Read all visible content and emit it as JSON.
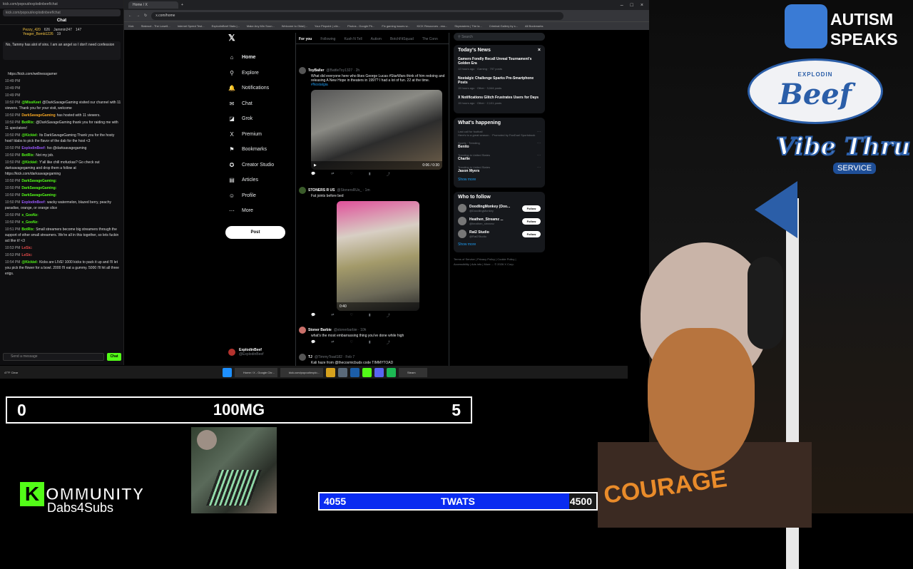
{
  "chat_window": {
    "title": "kick.com/popout/explodinbeef/chat",
    "url": "kick.com/popout/explodinbeef/chat",
    "header": "Chat",
    "leaderboard": [
      {
        "name": "Pezzy_420",
        "count": "626"
      },
      {
        "name": "Jammin247",
        "count": "147"
      },
      {
        "name": "Yeager_Bomb1226",
        "count": "19"
      }
    ],
    "pinned": "No, Tammy has alot of sins. I am an angel so I don't need confession",
    "messages": [
      {
        "time": "",
        "user": "",
        "text": "https://kick.com/wellnessgamer",
        "color": "#ffffff"
      },
      {
        "time": "10:49 PM",
        "user": "",
        "text": "",
        "color": "#e84b4b"
      },
      {
        "time": "10:49 PM",
        "user": "",
        "text": "",
        "color": "#e84b4b"
      },
      {
        "time": "10:49 PM",
        "user": "",
        "text": "",
        "color": "#e84b4b"
      },
      {
        "time": "10:50 PM",
        "user": "@MissKeet",
        "text": "@DarkSavageGaming visited our channel with 11 viewers. Thank you for your visit, welcome",
        "color": "#53fc18"
      },
      {
        "time": "10:50 PM",
        "user": "DarkSavageGaming",
        "text": "has hosted with 11 viewers.",
        "color": "#f5a623"
      },
      {
        "time": "10:50 PM",
        "user": "BotRix:",
        "text": "@DarkSavageGaming thank you for raiding me with 11 spectators!",
        "color": "#53fc18"
      },
      {
        "time": "10:50 PM",
        "user": "@Kickiel:",
        "text": "Its DarkSavageGaming Thank you for the hosty host! Idabs to pick the flavor of the dab for the host <3",
        "color": "#53fc18"
      },
      {
        "time": "10:50 PM",
        "user": "ExplodinBeef:",
        "text": "fso @darksavagegaming",
        "color": "#9b59ff"
      },
      {
        "time": "10:50 PM",
        "user": "BotRix:",
        "text": "Not my job.",
        "color": "#53fc18"
      },
      {
        "time": "10:50 PM",
        "user": "@Kickiel:",
        "text": "Y'all like chill mofuckas? Go check out darksavagegaming and drop them a follow at https://kick.com/darksavagegaming",
        "color": "#53fc18"
      },
      {
        "time": "10:50 PM",
        "user": "DarkSavageGaming:",
        "text": "",
        "color": "#53fc18"
      },
      {
        "time": "10:50 PM",
        "user": "DarkSavageGaming:",
        "text": "",
        "color": "#53fc18"
      },
      {
        "time": "10:50 PM",
        "user": "DarkSavageGaming:",
        "text": "",
        "color": "#53fc18"
      },
      {
        "time": "10:50 PM",
        "user": "ExplodinBeef:",
        "text": "wacky watermelon, blazed berry, peachy paradise, orange, or orange slice",
        "color": "#9b59ff"
      },
      {
        "time": "10:50 PM",
        "user": "x_GooNz:",
        "text": "",
        "color": "#53fc18"
      },
      {
        "time": "10:50 PM",
        "user": "x_GooNz:",
        "text": "",
        "color": "#53fc18"
      },
      {
        "time": "10:51 PM",
        "user": "BotRix:",
        "text": "Small streamers become big streamers through the support of other small streamers. We're all in this together, so lets fuckin act like it! <3",
        "color": "#53fc18"
      },
      {
        "time": "10:53 PM",
        "user": "LeSic:",
        "text": "",
        "color": "#e84b4b"
      },
      {
        "time": "10:53 PM",
        "user": "LeSic:",
        "text": "",
        "color": "#e84b4b"
      },
      {
        "time": "10:54 PM",
        "user": "@Kickiel:",
        "text": "Kicks are LIVE! 1000 kicks to pack it up and I'll let you pick the flower for a bowl. 2000 I'll eat a gummy. 5000 I'll hit all three erigs.",
        "color": "#53fc18"
      }
    ],
    "send_placeholder": "Send a message",
    "chat_button": "Chat"
  },
  "browser": {
    "tab_title": "Home / X",
    "url": "x.com/home",
    "bookmarks": [
      "Kick",
      "Stakroot - The Lowell...",
      "Internet Speed Test...",
      "ExplodinBeef Stats |...",
      "Make Any Min Soun...",
      "Welcome to Okta!|...",
      "Your Pinpoint | clin...",
      "Photos - Google Ph...",
      "Fix gaming issues w...",
      "KICK Resources - ess...",
      "Skymasters | The la...",
      "Criminal Gallery by s...",
      "All Bookmarks"
    ]
  },
  "x_nav": {
    "items": [
      {
        "label": "Home",
        "icon": "home-icon",
        "glyph": "⌂"
      },
      {
        "label": "Explore",
        "icon": "search-icon",
        "glyph": "⚲"
      },
      {
        "label": "Notifications",
        "icon": "bell-icon",
        "glyph": "🔔"
      },
      {
        "label": "Chat",
        "icon": "chat-icon",
        "glyph": "✉"
      },
      {
        "label": "Grok",
        "icon": "grok-icon",
        "glyph": "◪"
      },
      {
        "label": "Premium",
        "icon": "x-icon",
        "glyph": "X"
      },
      {
        "label": "Bookmarks",
        "icon": "bookmark-icon",
        "glyph": "⚑"
      },
      {
        "label": "Creator Studio",
        "icon": "creator-icon",
        "glyph": "✪"
      },
      {
        "label": "Articles",
        "icon": "articles-icon",
        "glyph": "▤"
      },
      {
        "label": "Profile",
        "icon": "profile-icon",
        "glyph": "☺"
      },
      {
        "label": "More",
        "icon": "more-icon",
        "glyph": "⋯"
      }
    ],
    "post_button": "Post",
    "profile_name": "ExplodinBeef",
    "profile_handle": "@ExplodinBeef"
  },
  "feed": {
    "tabs": [
      "For you",
      "Following",
      "Kush N Tell",
      "Autism",
      "BotchFitSquad",
      "The Conn"
    ],
    "posts": [
      {
        "name": "ToyBaller",
        "handle": "@BattleToy1327 · 2h",
        "text": "What did everyone here who likes George Lucas #StarWars think of him redoing and releasing A New Hope in theaters in 1997? I had a lot of fun. 22 at the time.",
        "tag": "#Nostalgia",
        "video_time": "0:06 / 0:30"
      },
      {
        "name": "STONERS R US",
        "handle": "@StonersRUs_ · 1m",
        "text": "Fat joints before bed",
        "video_time": "0:40"
      },
      {
        "name": "Stoner Barbie",
        "handle": "@stonerbarbie · 10h",
        "text": "what's the most embarrassing thing you've done while high"
      },
      {
        "name": "TJ",
        "handle": "@TimmyToad182 · Feb 7",
        "text": "Kali haze from @thecosmicbuds code TIMMYTOAD"
      }
    ]
  },
  "right": {
    "search_placeholder": "Search",
    "news_title": "Today's News",
    "news": [
      {
        "title": "Gamers Fondly Recall Unreal Tournament's Golden Era",
        "meta": "12 hours ago · Gaming · 797 posts"
      },
      {
        "title": "Nostalgic Challenge Sparks Pre-Smartphone Posts",
        "meta": "15 hours ago · Other · 3,044 posts"
      },
      {
        "title": "X Notifications Glitch Frustrates Users for Days",
        "meta": "15 hours ago · Other · 2,101 posts"
      }
    ],
    "happening_title": "What's happening",
    "trends": [
      {
        "context": "Last call for football",
        "name": "",
        "meta": "Here's to a great season. · Promoted by FanDuel Sportsbook"
      },
      {
        "context": "Sports · Trending",
        "name": "Benito",
        "meta": ""
      },
      {
        "context": "Trending in United States",
        "name": "Charlie",
        "meta": ""
      },
      {
        "context": "Trending in United States",
        "name": "Jason Myers",
        "meta": ""
      }
    ],
    "show_more": "Show more",
    "follow_title": "Who to follow",
    "follow": [
      {
        "name": "DoodlingMonkey (Doo...",
        "handle": "@DoodlingMonkey"
      },
      {
        "name": "Heathen_Streamz ...",
        "handle": "@heathen_streamz"
      },
      {
        "name": "Rat2 Studio",
        "handle": "@Rat2Studio"
      }
    ],
    "follow_label": "Follow",
    "footer": "Terms of Service | Privacy Policy | Cookie Policy | Accessibility | Ads info | More ... © 2026 X Corp."
  },
  "taskbar": {
    "weather": "47°F Clear",
    "items": [
      "Home / X - Google Chr...",
      "kick.com/popout/explo...",
      "Steam"
    ]
  },
  "overlays": {
    "score_left": "0",
    "score_title": "100MG",
    "score_right": "5",
    "kommunity_letter": "K",
    "kommunity_title": "OMMUNITY",
    "kommunity_sub": "Dabs4Subs",
    "goal_current": "4055",
    "goal_label": "TWATS",
    "goal_target": "4500",
    "goal_fraction": 0.901,
    "autism_line1": "AUTISM",
    "autism_line2": "SPEAKS",
    "sign_top": "EXPLODIN",
    "sign_main": "Beef",
    "sign_script": "Vibe Thru",
    "sign_service": "SERVICE",
    "shirt_text": "COURAGE"
  }
}
